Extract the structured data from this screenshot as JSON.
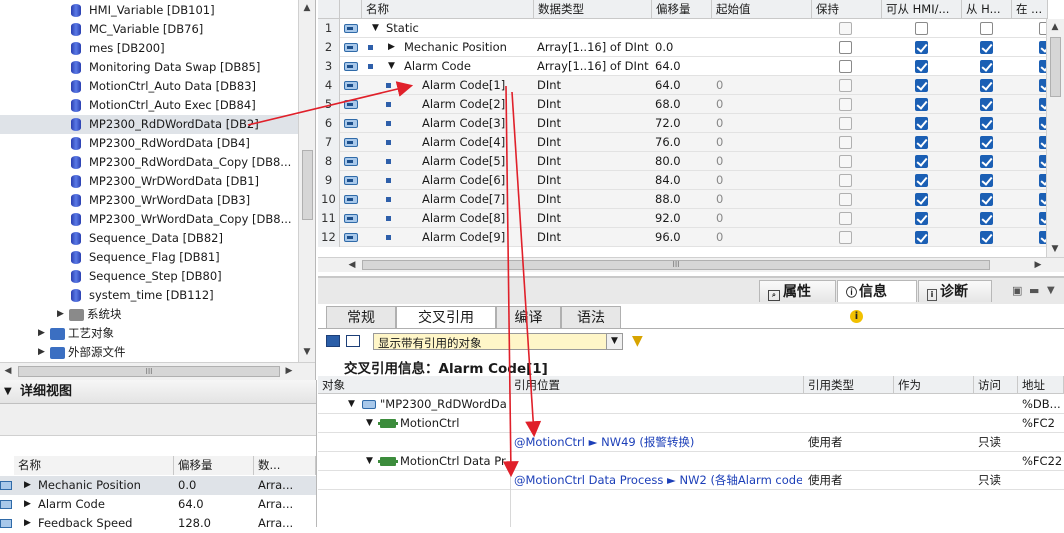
{
  "tree": {
    "items": [
      {
        "label": "HMI_Variable [DB101]"
      },
      {
        "label": "MC_Variable [DB76]"
      },
      {
        "label": "mes [DB200]"
      },
      {
        "label": "Monitoring Data Swap [DB85]"
      },
      {
        "label": "MotionCtrl_Auto Data [DB83]"
      },
      {
        "label": "MotionCtrl_Auto Exec [DB84]"
      },
      {
        "label": "MP2300_RdDWordData [DB2]"
      },
      {
        "label": "MP2300_RdWordData [DB4]"
      },
      {
        "label": "MP2300_RdWordData_Copy [DB8..."
      },
      {
        "label": "MP2300_WrDWordData [DB1]"
      },
      {
        "label": "MP2300_WrWordData [DB3]"
      },
      {
        "label": "MP2300_WrWordData_Copy [DB8..."
      },
      {
        "label": "Sequence_Data [DB82]"
      },
      {
        "label": "Sequence_Flag [DB81]"
      },
      {
        "label": "Sequence_Step [DB80]"
      },
      {
        "label": "system_time [DB112]"
      }
    ],
    "folders": [
      {
        "label": "系统块"
      },
      {
        "label": "工艺对象"
      },
      {
        "label": "外部源文件"
      }
    ],
    "scroll_glyph": "III"
  },
  "detail": {
    "title": "详细视图",
    "columns": [
      "名称",
      "偏移量",
      "数..."
    ],
    "rows": [
      {
        "name": "Mechanic Position",
        "offset": "0.0",
        "type": "Arra..."
      },
      {
        "name": "Alarm Code",
        "offset": "64.0",
        "type": "Arra..."
      },
      {
        "name": "Feedback Speed",
        "offset": "128.0",
        "type": "Arra..."
      }
    ]
  },
  "grid": {
    "columns": [
      "名称",
      "数据类型",
      "偏移量",
      "起始值",
      "保持",
      "可从 HMI/...",
      "从 H...",
      "在 ..."
    ],
    "rows": [
      {
        "num": "1",
        "name": "Static",
        "type": "",
        "offset": "",
        "start": "",
        "level": 0,
        "expand": "▼",
        "c": [
          false,
          false,
          false
        ],
        "dis": true
      },
      {
        "num": "2",
        "name": "Mechanic Position",
        "type": "Array[1..16] of DInt",
        "offset": "0.0",
        "start": "",
        "level": 1,
        "expand": "▶",
        "c": [
          false,
          true,
          true
        ]
      },
      {
        "num": "3",
        "name": "Alarm Code",
        "type": "Array[1..16] of DInt",
        "offset": "64.0",
        "start": "",
        "level": 1,
        "expand": "▼",
        "c": [
          false,
          true,
          true
        ]
      },
      {
        "num": "4",
        "name": "Alarm Code[1]",
        "type": "DInt",
        "offset": "64.0",
        "start": "0",
        "level": 2,
        "expand": "",
        "c": [
          false,
          true,
          true
        ],
        "dis": true
      },
      {
        "num": "5",
        "name": "Alarm Code[2]",
        "type": "DInt",
        "offset": "68.0",
        "start": "0",
        "level": 2,
        "expand": "",
        "c": [
          false,
          true,
          true
        ],
        "dis": true
      },
      {
        "num": "6",
        "name": "Alarm Code[3]",
        "type": "DInt",
        "offset": "72.0",
        "start": "0",
        "level": 2,
        "expand": "",
        "c": [
          false,
          true,
          true
        ],
        "dis": true
      },
      {
        "num": "7",
        "name": "Alarm Code[4]",
        "type": "DInt",
        "offset": "76.0",
        "start": "0",
        "level": 2,
        "expand": "",
        "c": [
          false,
          true,
          true
        ],
        "dis": true
      },
      {
        "num": "8",
        "name": "Alarm Code[5]",
        "type": "DInt",
        "offset": "80.0",
        "start": "0",
        "level": 2,
        "expand": "",
        "c": [
          false,
          true,
          true
        ],
        "dis": true
      },
      {
        "num": "9",
        "name": "Alarm Code[6]",
        "type": "DInt",
        "offset": "84.0",
        "start": "0",
        "level": 2,
        "expand": "",
        "c": [
          false,
          true,
          true
        ],
        "dis": true
      },
      {
        "num": "10",
        "name": "Alarm Code[7]",
        "type": "DInt",
        "offset": "88.0",
        "start": "0",
        "level": 2,
        "expand": "",
        "c": [
          false,
          true,
          true
        ],
        "dis": true
      },
      {
        "num": "11",
        "name": "Alarm Code[8]",
        "type": "DInt",
        "offset": "92.0",
        "start": "0",
        "level": 2,
        "expand": "",
        "c": [
          false,
          true,
          true
        ],
        "dis": true
      },
      {
        "num": "12",
        "name": "Alarm Code[9]",
        "type": "DInt",
        "offset": "96.0",
        "start": "0",
        "level": 2,
        "expand": "",
        "c": [
          false,
          true,
          true
        ],
        "dis": true
      }
    ],
    "scroll_glyph": "III"
  },
  "inspector": {
    "tabs": [
      "属性",
      "信息",
      "诊断"
    ],
    "subtabs": [
      "常规",
      "交叉引用",
      "编译",
      "语法"
    ],
    "filter_value": "显示带有引用的对象",
    "heading": "交叉引用信息：Alarm Code[1]",
    "columns": [
      "对象",
      "引用位置",
      "引用类型",
      "作为",
      "访问",
      "地址"
    ],
    "rows": [
      {
        "object": "\"MP2300_RdDWordDa...",
        "location": "",
        "reftype": "",
        "as": "",
        "access": "",
        "addr": "%DB..."
      },
      {
        "object": "MotionCtrl",
        "location": "",
        "reftype": "",
        "as": "",
        "access": "",
        "addr": "%FC2"
      },
      {
        "object": "",
        "location": "@MotionCtrl ► NW49 (报警转换)",
        "reftype": "使用者",
        "as": "",
        "access": "只读",
        "addr": ""
      },
      {
        "object": "MotionCtrl Data Pr...",
        "location": "",
        "reftype": "",
        "as": "",
        "access": "",
        "addr": "%FC22"
      },
      {
        "object": "",
        "location": "@MotionCtrl Data Process ► NW2 (各轴Alarm code...",
        "reftype": "使用者",
        "as": "",
        "access": "只读",
        "addr": ""
      }
    ]
  },
  "colors": {
    "accent": "#1b5fb4",
    "arrow": "#e0202a",
    "link": "#1c3fb8"
  }
}
